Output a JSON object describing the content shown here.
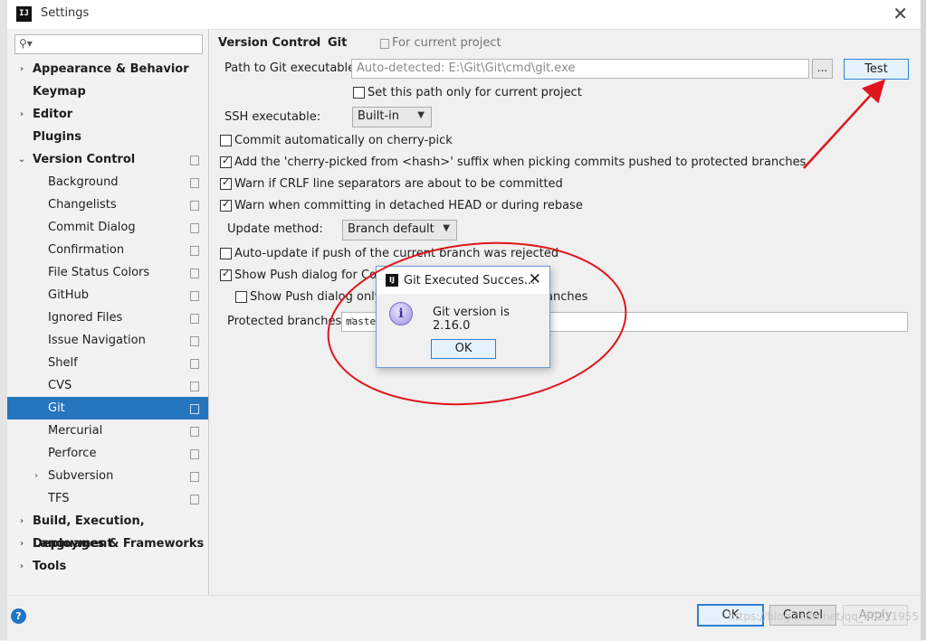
{
  "window": {
    "title": "Settings",
    "logo": "IJ"
  },
  "sidebar": {
    "search_placeholder": "",
    "items": [
      {
        "label": "Appearance & Behavior",
        "level": 0,
        "bold": true,
        "arrow": "collapsed"
      },
      {
        "label": "Keymap",
        "level": 0,
        "bold": true,
        "arrow": "none"
      },
      {
        "label": "Editor",
        "level": 0,
        "bold": true,
        "arrow": "collapsed"
      },
      {
        "label": "Plugins",
        "level": 0,
        "bold": true,
        "arrow": "none"
      },
      {
        "label": "Version Control",
        "level": 0,
        "bold": true,
        "arrow": "expanded",
        "copy_icon": true
      },
      {
        "label": "Background",
        "level": 1,
        "copy_icon": true
      },
      {
        "label": "Changelists",
        "level": 1,
        "copy_icon": true
      },
      {
        "label": "Commit Dialog",
        "level": 1,
        "copy_icon": true
      },
      {
        "label": "Confirmation",
        "level": 1,
        "copy_icon": true
      },
      {
        "label": "File Status Colors",
        "level": 1,
        "copy_icon": true
      },
      {
        "label": "GitHub",
        "level": 1,
        "copy_icon": true
      },
      {
        "label": "Ignored Files",
        "level": 1,
        "copy_icon": true
      },
      {
        "label": "Issue Navigation",
        "level": 1,
        "copy_icon": true
      },
      {
        "label": "Shelf",
        "level": 1,
        "copy_icon": true
      },
      {
        "label": "CVS",
        "level": 1,
        "copy_icon": true
      },
      {
        "label": "Git",
        "level": 1,
        "copy_icon": true,
        "selected": true
      },
      {
        "label": "Mercurial",
        "level": 1,
        "copy_icon": true
      },
      {
        "label": "Perforce",
        "level": 1,
        "copy_icon": true
      },
      {
        "label": "Subversion",
        "level": 1,
        "copy_icon": true,
        "arrow": "collapsed"
      },
      {
        "label": "TFS",
        "level": 1,
        "copy_icon": true
      },
      {
        "label": "Build, Execution, Deployment",
        "level": 0,
        "bold": true,
        "arrow": "collapsed"
      },
      {
        "label": "Languages & Frameworks",
        "level": 0,
        "bold": true,
        "arrow": "collapsed"
      },
      {
        "label": "Tools",
        "level": 0,
        "bold": true,
        "arrow": "collapsed"
      }
    ]
  },
  "header": {
    "crumb_parent": "Version Control",
    "crumb_separator": "›",
    "crumb_current": "Git",
    "scope": "For current project"
  },
  "git_settings": {
    "path_label": "Path to Git executable:",
    "path_placeholder": "Auto-detected: E:\\Git\\Git\\cmd\\git.exe",
    "browse_label": "...",
    "test_label": "Test",
    "set_path_label": "Set this path only for current project",
    "set_path_checked": false,
    "ssh_label": "SSH executable:",
    "ssh_value": "Built-in",
    "commit_cherry_label": "Commit automatically on cherry-pick",
    "commit_cherry_checked": false,
    "cherry_suffix_label": "Add the 'cherry-picked from <hash>' suffix when picking commits pushed to protected branches",
    "cherry_suffix_checked": true,
    "crlf_label": "Warn if CRLF line separators are about to be committed",
    "crlf_checked": true,
    "detached_label": "Warn when committing in detached HEAD or during rebase",
    "detached_checked": true,
    "update_method_label": "Update method:",
    "update_method_value": "Branch default",
    "auto_update_label": "Auto-update if push of the current branch was rejected",
    "auto_update_checked": false,
    "show_push_label": "Show Push dialog for Com",
    "show_push_checked": true,
    "show_push_only_label": "Show Push dialog only w",
    "show_push_only_tail": "anches",
    "show_push_only_checked": false,
    "protected_label": "Protected branches:",
    "protected_value": "maste"
  },
  "dialog": {
    "title": "Git Executed Succes...",
    "message": "Git version is 2.16.0",
    "ok_label": "OK",
    "logo": "IJ",
    "info_glyph": "i"
  },
  "footer": {
    "help_label": "?",
    "ok_label": "OK",
    "cancel_label": "Cancel",
    "apply_label": "Apply",
    "watermark": "https://blog.csdn.net/qq_30211955"
  },
  "annotations": {
    "color": "#e0151d"
  }
}
